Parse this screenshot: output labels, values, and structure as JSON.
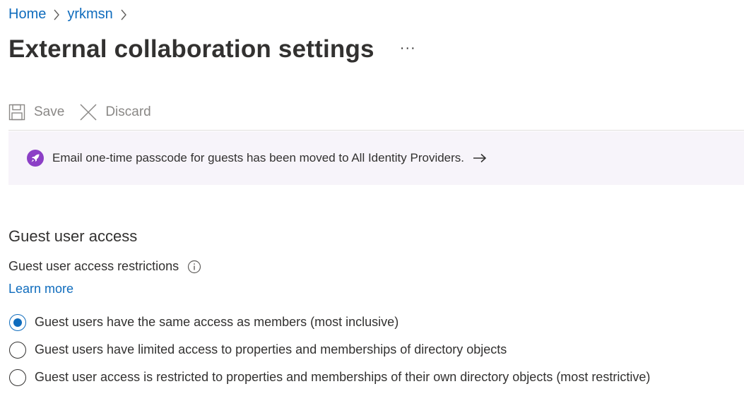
{
  "breadcrumb": {
    "items": [
      "Home",
      "yrkmsn"
    ]
  },
  "header": {
    "title": "External collaboration settings",
    "more_label": "···"
  },
  "toolbar": {
    "save_label": "Save",
    "discard_label": "Discard",
    "disabled": true
  },
  "banner": {
    "text": "Email one-time passcode for guests has been moved to All Identity Providers.",
    "icon": "rocket-icon",
    "accent": "#8c3fc6"
  },
  "guest_access": {
    "section_title": "Guest user access",
    "field_label": "Guest user access restrictions",
    "learn_more": "Learn more",
    "options": [
      {
        "label": "Guest users have the same access as members (most inclusive)",
        "selected": true
      },
      {
        "label": "Guest users have limited access to properties and memberships of directory objects",
        "selected": false
      },
      {
        "label": "Guest user access is restricted to properties and memberships of their own directory objects (most restrictive)",
        "selected": false
      }
    ]
  },
  "colors": {
    "link": "#0f6cbd",
    "text": "#323130",
    "disabled": "#8a8886",
    "banner_bg": "#f7f4fa"
  }
}
